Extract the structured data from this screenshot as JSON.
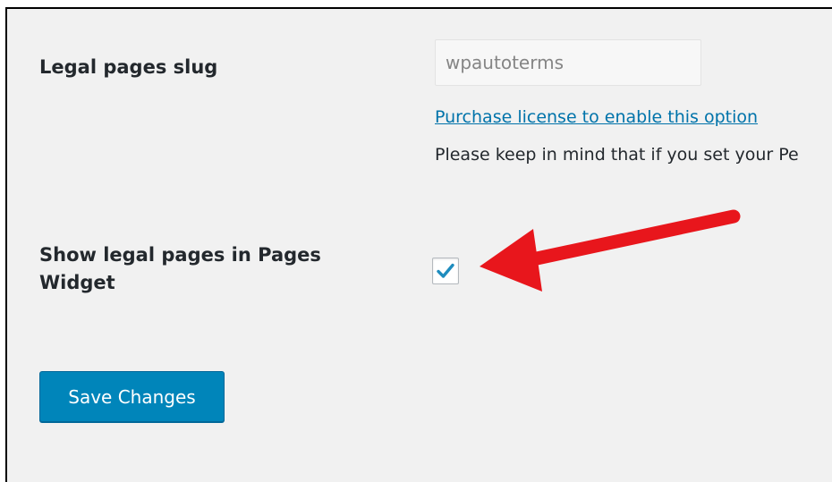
{
  "settings": {
    "slug": {
      "label": "Legal pages slug",
      "value": "wpautoterms",
      "purchase_link": "Purchase license to enable this option",
      "note": "Please keep in mind that if you set your Pe"
    },
    "widget": {
      "label": "Show legal pages in Pages Widget",
      "checked": true
    }
  },
  "actions": {
    "save_label": "Save Changes"
  },
  "colors": {
    "accent": "#0085ba",
    "link": "#0073aa",
    "arrow": "#e8161c"
  }
}
